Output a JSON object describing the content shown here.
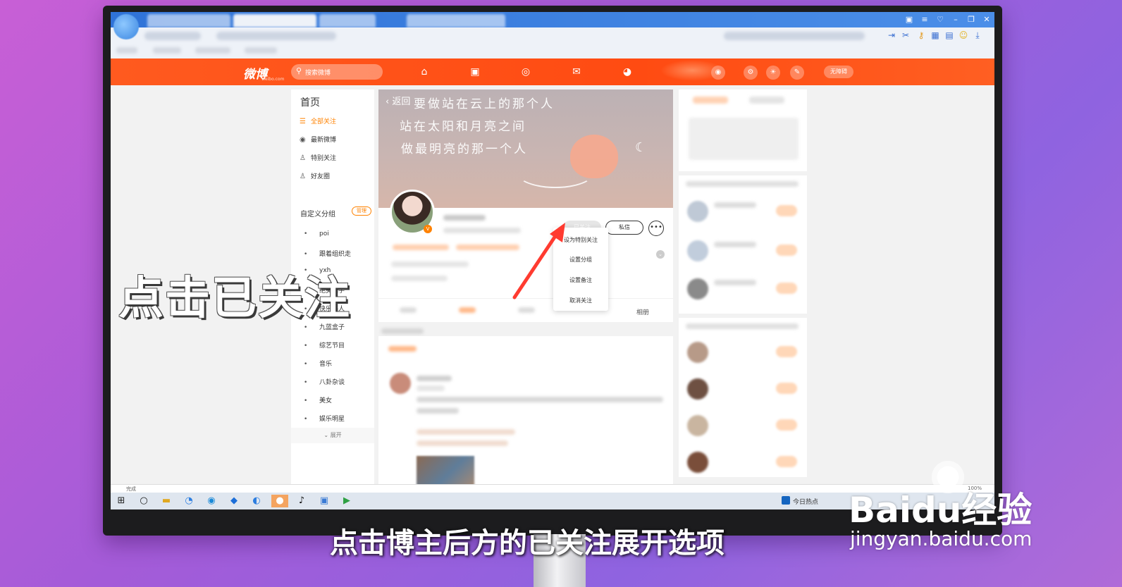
{
  "video_overlay": {
    "title": "点击已关注",
    "subtitle": "点击博主后方的已关注展开选项",
    "watermark_logo": "Baidu经验",
    "watermark_url": "jingyan.baidu.com"
  },
  "weibo_nav": {
    "logo": "微博",
    "logo_sub": "weibo.com",
    "search_placeholder": "搜索微博",
    "nav_icons": [
      "home-icon",
      "video-icon",
      "hot-icon",
      "mail-icon",
      "avatar-icon"
    ],
    "right_button": "无障碍"
  },
  "sidebar": {
    "title": "首页",
    "items": [
      {
        "label": "全部关注",
        "icon": "list-icon"
      },
      {
        "label": "最新微博",
        "icon": "clock-icon"
      },
      {
        "label": "特别关注",
        "icon": "user-star-icon"
      },
      {
        "label": "好友圈",
        "icon": "friends-icon"
      }
    ],
    "group_title": "自定义分组",
    "manage_label": "管理",
    "groups": [
      "poi",
      "跟着组织走",
      "yxh",
      "绝美画手",
      "快乐路人",
      "九蓝盒子",
      "综艺节目",
      "音乐",
      "八卦杂谈",
      "美女",
      "娱乐明星"
    ],
    "expand_label": "展开"
  },
  "profile": {
    "back_label": "返回",
    "cover_text": [
      "要做站在云上的那个人",
      "站在太阳和月亮之间",
      "做最明亮的那一个人"
    ],
    "follow_label": "已关注",
    "message_label": "私信",
    "more_label": "•••",
    "tab_photos": "相册"
  },
  "follow_menu": {
    "items": [
      "设为特别关注",
      "设置分组",
      "设置备注",
      "取消关注"
    ]
  },
  "browser": {
    "status_text": "完成",
    "zoom": "100%",
    "taskbar_hot": "今日热点"
  },
  "colors": {
    "weibo_orange": "#ff5a1f",
    "accent": "#ff8200",
    "arrow": "#ff3b30"
  }
}
